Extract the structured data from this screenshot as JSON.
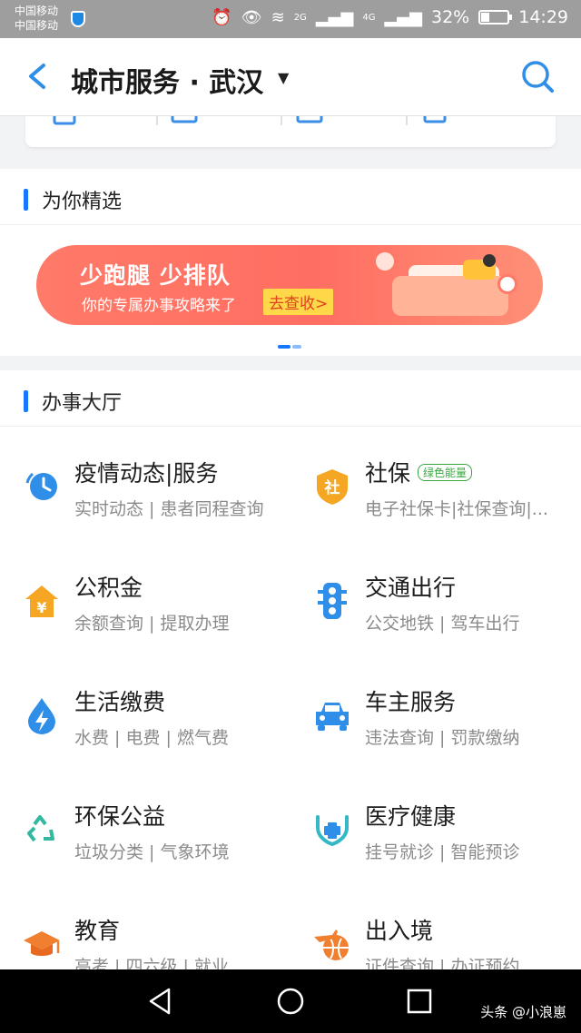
{
  "status_bar": {
    "carrier_line1": "中国移动",
    "carrier_line2": "中国移动",
    "network1": "2G",
    "network2": "4G",
    "battery_text": "32%",
    "battery_level": 0.32,
    "time": "14:29"
  },
  "header": {
    "title": "城市服务 · 武汉",
    "caret_icon": "triangle-down",
    "back_icon": "chevron-left",
    "search_icon": "magnifier"
  },
  "colors": {
    "accent": "#1677ff",
    "icon_blue": "#2f8ee8",
    "icon_orange": "#f5a623",
    "tag_green": "#3aa840",
    "banner": "#ff6e62",
    "banner_cta": "#ffd84a"
  },
  "featured": {
    "label": "为你精选",
    "banner_headline": "少跑腿 少排队",
    "banner_subline": "你的专属办事攻略来了",
    "banner_cta": "去查收>"
  },
  "hall": {
    "label": "办事大厅",
    "services": [
      {
        "title": "疫情动态|服务",
        "sub": "实时动态 | 患者同程查询",
        "icon": "clock-icon"
      },
      {
        "title": "社保",
        "tag": "绿色能量",
        "sub": "电子社保卡|社保查询|...",
        "icon": "shield-she-icon"
      },
      {
        "title": "公积金",
        "sub": "余额查询 | 提取办理",
        "icon": "house-yuan-icon"
      },
      {
        "title": "交通出行",
        "sub": "公交地铁 | 驾车出行",
        "icon": "traffic-light-icon"
      },
      {
        "title": "生活缴费",
        "sub": "水费 | 电费 | 燃气费",
        "icon": "water-bolt-icon"
      },
      {
        "title": "车主服务",
        "sub": "违法查询 | 罚款缴纳",
        "icon": "car-icon"
      },
      {
        "title": "环保公益",
        "sub": "垃圾分类 | 气象环境",
        "icon": "recycle-icon"
      },
      {
        "title": "医疗健康",
        "sub": "挂号就诊 | 智能预诊",
        "icon": "stethoscope-icon"
      },
      {
        "title": "教育",
        "sub": "高考 | 四六级 | 就业",
        "icon": "graduation-cap-icon"
      },
      {
        "title": "出入境",
        "sub": "证件查询 | 办证预约",
        "icon": "plane-globe-icon"
      }
    ]
  },
  "watermark": "头条 @小浪崽"
}
